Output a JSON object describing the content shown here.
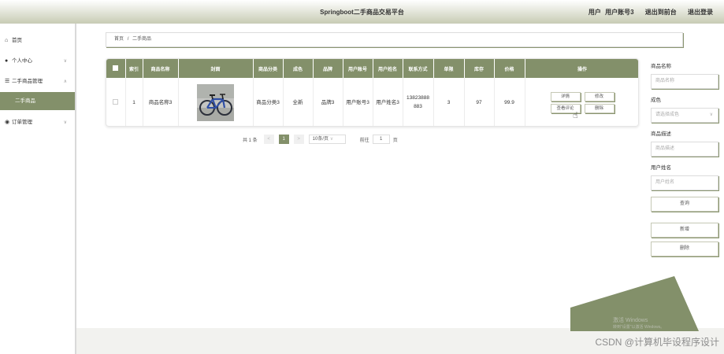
{
  "header": {
    "title": "Springboot二手商品交易平台",
    "user_role": "用户",
    "user_name": "用户账号3",
    "back_label": "退出到前台",
    "logout_label": "退出登录"
  },
  "sidebar": {
    "items": [
      {
        "label": "首页",
        "icon": "home-icon"
      },
      {
        "label": "个人中心",
        "icon": "user-icon"
      },
      {
        "label": "二手商品管理",
        "icon": "sliders-icon"
      },
      {
        "label": "二手商品",
        "icon": ""
      },
      {
        "label": "订单管理",
        "icon": "location-icon"
      }
    ]
  },
  "breadcrumb": {
    "home": "首页",
    "separator": "/",
    "current": "二手商品"
  },
  "table": {
    "headers": [
      "索引",
      "商品名称",
      "封面",
      "商品分类",
      "成色",
      "品牌",
      "用户账号",
      "用户姓名",
      "联系方式",
      "单限",
      "库存",
      "价格",
      "操作"
    ],
    "rows": [
      {
        "index": "1",
        "name": "商品名称3",
        "category": "商品分类3",
        "condition": "全新",
        "brand": "品牌3",
        "account": "用户账号3",
        "username": "用户姓名3",
        "phone": "13823888883",
        "limit": "3",
        "stock": "97",
        "price": "99.9",
        "ops": {
          "detail": "详情",
          "edit": "修改",
          "review": "查看评论",
          "delete": "删除"
        }
      }
    ]
  },
  "pager": {
    "total": "共 1 条",
    "prev": "<",
    "page": "1",
    "next": ">",
    "size": "10条/页",
    "goto": "前往",
    "goto_value": "1",
    "page_suffix": "页"
  },
  "filters": {
    "name_label": "商品名称",
    "name_placeholder": "商品名称",
    "condition_label": "成色",
    "condition_placeholder": "请选择成色",
    "desc_label": "商品描述",
    "desc_placeholder": "商品描述",
    "username_label": "用户姓名",
    "username_placeholder": "用户姓名",
    "search": "查询",
    "add": "新增",
    "delete": "删除"
  },
  "watermark": {
    "line1": "激活 Windows",
    "line2": "转到\"设置\"以激活 Windows。"
  },
  "csdn": "CSDN @计算机毕设程序设计",
  "colors": {
    "accent": "#83906a",
    "header_bg": "#c9cdb6"
  }
}
